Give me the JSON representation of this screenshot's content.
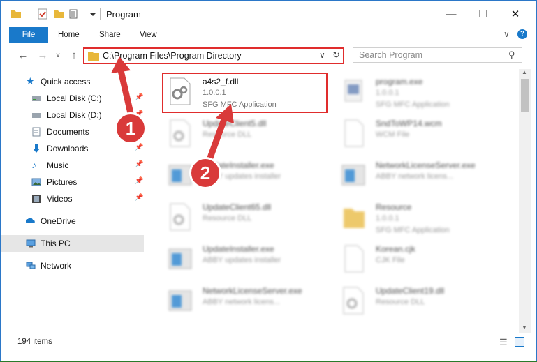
{
  "window": {
    "title": "Program",
    "minimize_icon": "minimize-icon",
    "maximize_icon": "maximize-icon",
    "close_icon": "close-icon"
  },
  "ribbon": {
    "tabs": [
      "File",
      "Home",
      "Share",
      "View"
    ]
  },
  "address_bar": {
    "path": "C:\\Program Files\\Program Directory"
  },
  "search": {
    "placeholder": "Search Program"
  },
  "nav_pane": {
    "quick_access": "Quick access",
    "items": [
      {
        "label": "Local Disk (C:)",
        "icon": "disk-icon",
        "pinned": true
      },
      {
        "label": "Local Disk (D:)",
        "icon": "disk-icon",
        "pinned": true
      },
      {
        "label": "Documents",
        "icon": "documents-icon",
        "pinned": true
      },
      {
        "label": "Downloads",
        "icon": "downloads-icon",
        "pinned": true
      },
      {
        "label": "Music",
        "icon": "music-icon",
        "pinned": true
      },
      {
        "label": "Pictures",
        "icon": "pictures-icon",
        "pinned": true
      },
      {
        "label": "Videos",
        "icon": "videos-icon",
        "pinned": true
      }
    ],
    "onedrive": "OneDrive",
    "this_pc": "This PC",
    "network": "Network"
  },
  "files": {
    "selected": {
      "name": "a4s2_f.dll",
      "line1": "1.0.0.1",
      "line2": "SFG MFC Application"
    },
    "left_column": [
      {
        "name": "UpdateClient5.dll",
        "line1": "Resource DLL",
        "line2": ""
      },
      {
        "name": "UpdateInstaller.exe",
        "line1": "ABBY updates installer",
        "line2": ""
      },
      {
        "name": "UpdateClient65.dll",
        "line1": "Resource DLL",
        "line2": ""
      },
      {
        "name": "UpdateInstaller.exe",
        "line1": "ABBY updates installer",
        "line2": ""
      },
      {
        "name": "NetworkLicenseServer.exe",
        "line1": "ABBY network licens...",
        "line2": ""
      }
    ],
    "right_column": [
      {
        "name": "program.exe",
        "line1": "1.0.0.1",
        "line2": "SFG MFC Application"
      },
      {
        "name": "SndToWP14.wcm",
        "line1": "WCM File",
        "line2": ""
      },
      {
        "name": "NetworkLicenseServer.exe",
        "line1": "ABBY network licens...",
        "line2": ""
      },
      {
        "name": "Resource",
        "line1": "1.0.0.1",
        "line2": "SFG MFC Application"
      },
      {
        "name": "Korean.cjk",
        "line1": "CJK File",
        "line2": ""
      },
      {
        "name": "UpdateClient19.dll",
        "line1": "Resource DLL",
        "line2": ""
      }
    ]
  },
  "status": {
    "item_count": "194 items"
  },
  "annotations": {
    "step1": "1",
    "step2": "2",
    "color": "#d93a3a"
  }
}
